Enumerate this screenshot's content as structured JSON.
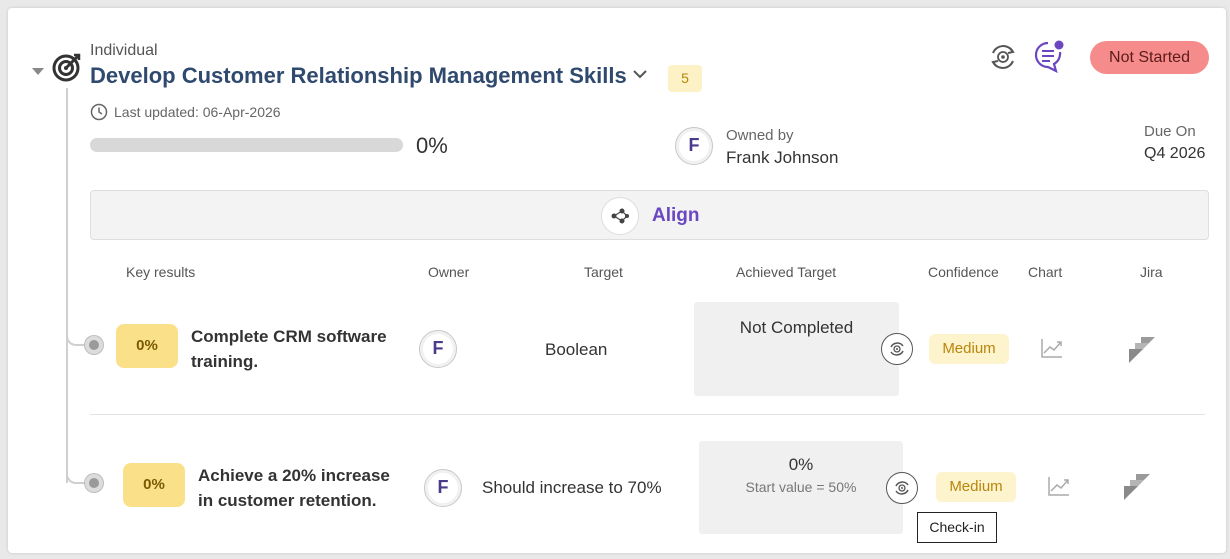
{
  "objective": {
    "type_label": "Individual",
    "title": "Develop Customer Relationship Management Skills",
    "count_badge": "5",
    "last_updated": "Last updated: 06-Apr-2026",
    "progress_text": "0%",
    "progress": 0,
    "owner_label": "Owned by",
    "owner_name": "Frank Johnson",
    "owner_initial": "F",
    "due_label": "Due On",
    "due_value": "Q4 2026",
    "status": "Not Started",
    "status_color": "#f58b8b"
  },
  "align": {
    "label": "Align"
  },
  "table": {
    "headers": {
      "key_results": "Key results",
      "owner": "Owner",
      "target": "Target",
      "achieved": "Achieved Target",
      "confidence": "Confidence",
      "chart": "Chart",
      "jira": "Jira"
    },
    "rows": [
      {
        "percent": "0%",
        "title_line1": "Complete CRM software",
        "title_line2": "training.",
        "owner_initial": "F",
        "target": "Boolean",
        "achieved": "Not Completed",
        "achieved_sub": "",
        "confidence": "Medium"
      },
      {
        "percent": "0%",
        "title_line1": "Achieve a 20% increase",
        "title_line2": "in customer retention.",
        "owner_initial": "F",
        "target": "Should increase to 70%",
        "achieved": "0%",
        "achieved_sub": "Start value = 50%",
        "confidence": "Medium"
      }
    ]
  },
  "tooltip": {
    "text": "Check-in"
  },
  "icons": {
    "target": "target-icon",
    "expand": "chevron-down-icon",
    "collapse": "caret-down-icon",
    "clock": "clock-icon",
    "checkin": "checkin-icon",
    "comments": "comments-icon",
    "align": "align-icon",
    "chart": "chart-icon",
    "jira": "jira-icon"
  },
  "colors": {
    "title": "#2f4a6e",
    "accent": "#6b46c1",
    "kr_badge": "#fbe08a",
    "confidence_bg": "#fdf3cd"
  }
}
